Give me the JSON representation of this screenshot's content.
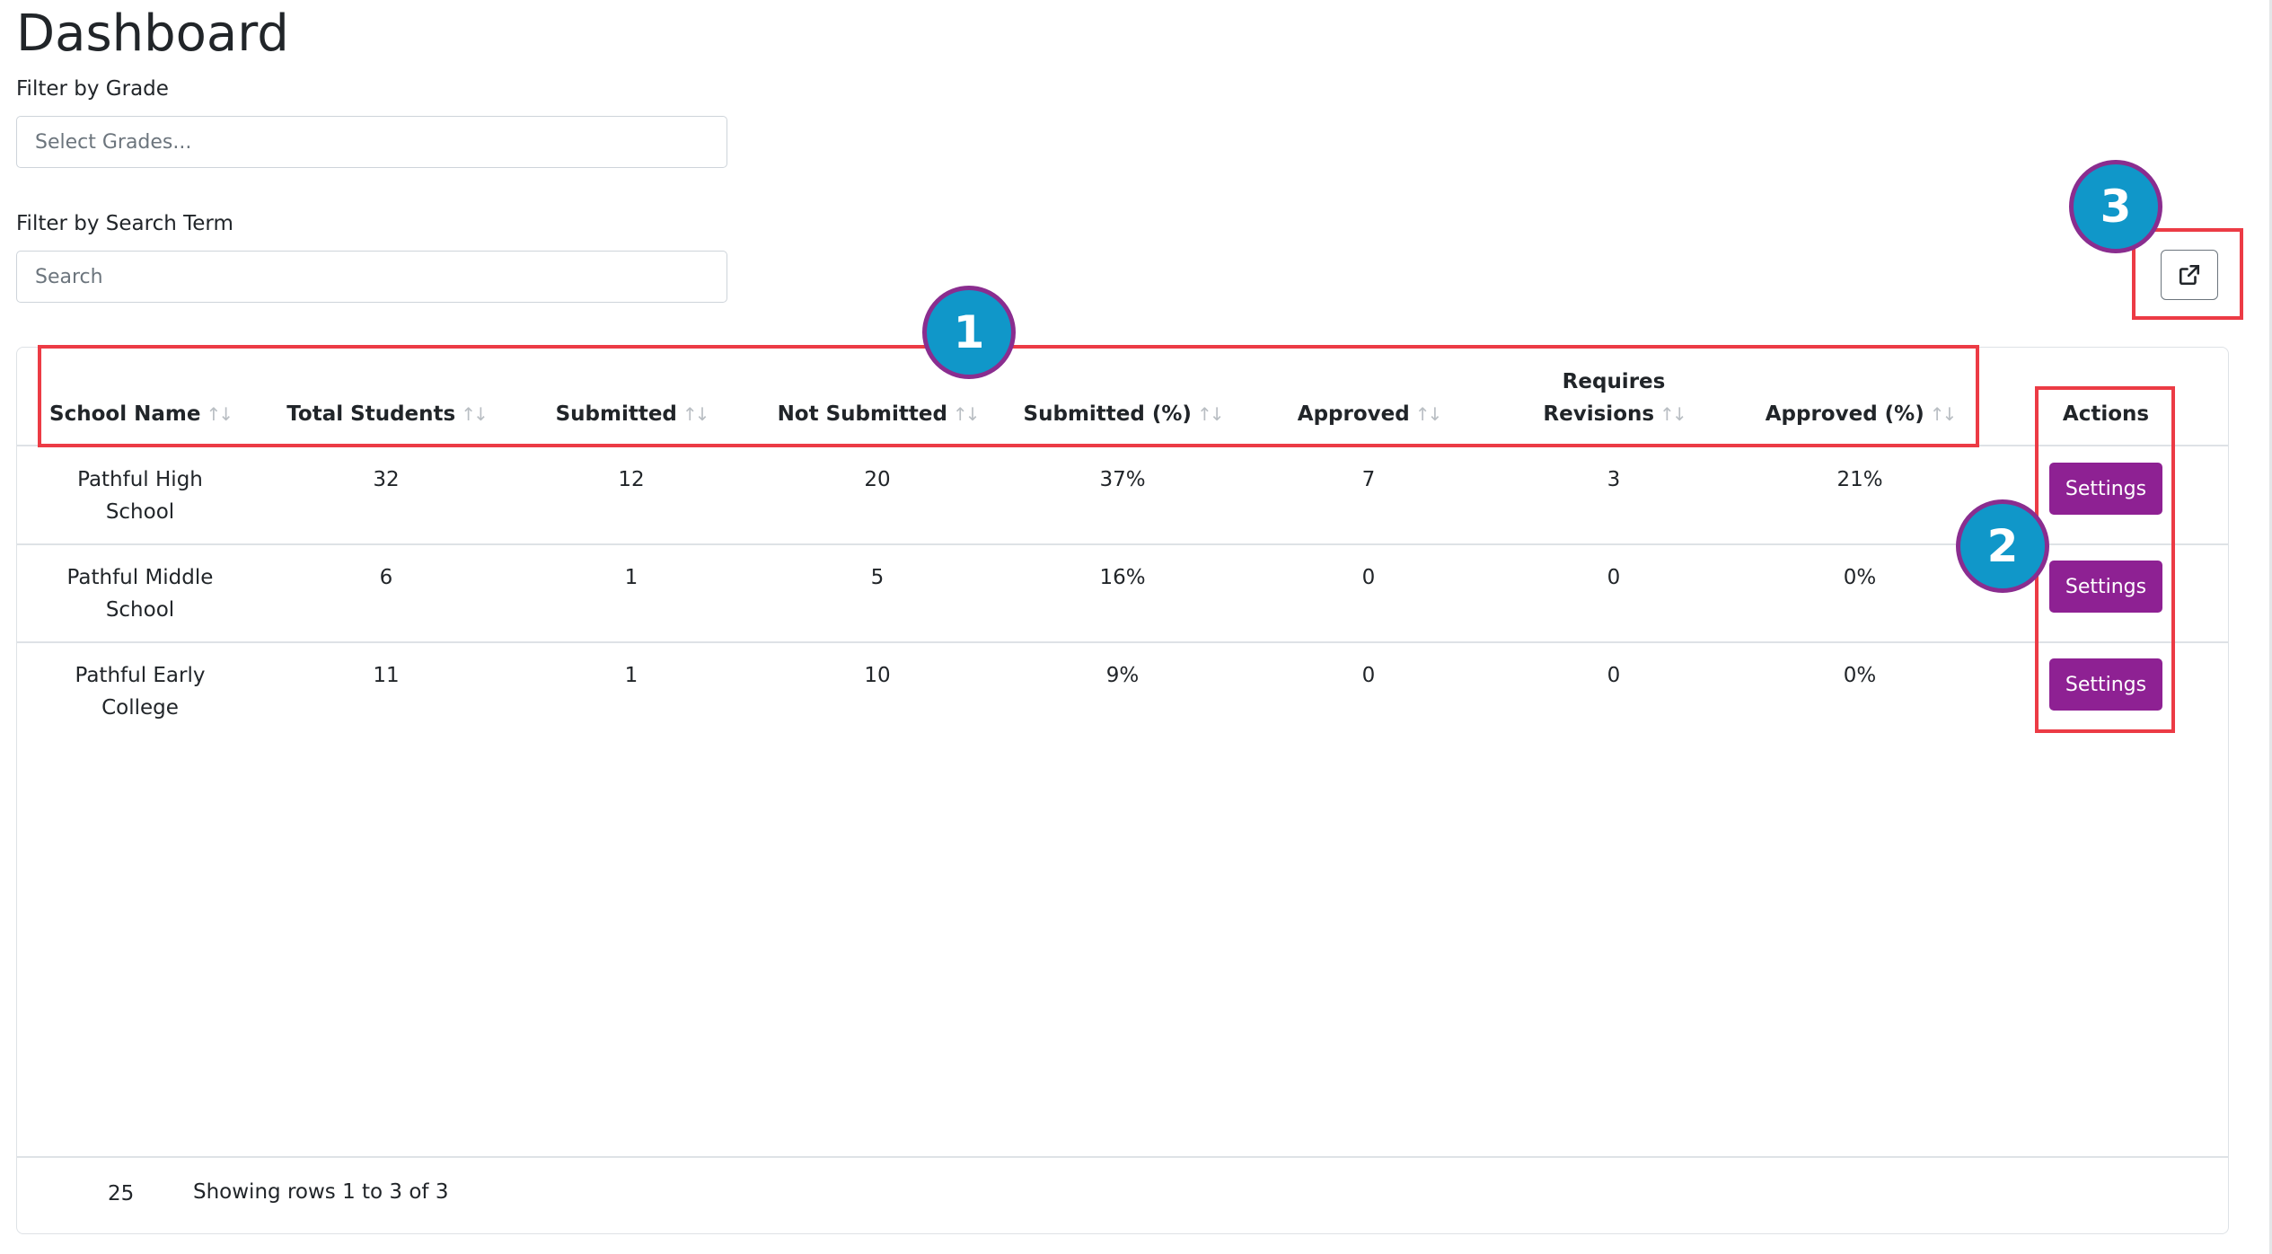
{
  "page": {
    "title": "Dashboard"
  },
  "filters": {
    "grade_label": "Filter by Grade",
    "grade_placeholder": "Select Grades...",
    "grade_value": "",
    "search_label": "Filter by Search Term",
    "search_placeholder": "Search",
    "search_value": ""
  },
  "toolbar": {
    "export_icon": "external-link-icon"
  },
  "table": {
    "columns": [
      {
        "label_lines": [
          "School Name"
        ],
        "sort_icon": "↑↓"
      },
      {
        "label_lines": [
          "Total Students"
        ],
        "sort_icon": "↑↓"
      },
      {
        "label_lines": [
          "Submitted"
        ],
        "sort_icon": "↑↓"
      },
      {
        "label_lines": [
          "Not Submitted"
        ],
        "sort_icon": "↑↓"
      },
      {
        "label_lines": [
          "Submitted (%)"
        ],
        "sort_icon": "↑↓"
      },
      {
        "label_lines": [
          "Approved"
        ],
        "sort_icon": "↑↓"
      },
      {
        "label_lines": [
          "Requires",
          "Revisions"
        ],
        "sort_icon": "↑↓"
      },
      {
        "label_lines": [
          "Approved (%)"
        ],
        "sort_icon": "↑↓"
      },
      {
        "label_lines": [
          "Actions"
        ],
        "sort_icon": ""
      }
    ],
    "rows": [
      {
        "school": "Pathful High School",
        "total": "32",
        "submitted": "12",
        "not_submitted": "20",
        "submitted_pct": "37%",
        "approved": "7",
        "revisions": "3",
        "approved_pct": "21%",
        "action": "Settings"
      },
      {
        "school": "Pathful Middle School",
        "total": "6",
        "submitted": "1",
        "not_submitted": "5",
        "submitted_pct": "16%",
        "approved": "0",
        "revisions": "0",
        "approved_pct": "0%",
        "action": "Settings"
      },
      {
        "school": "Pathful Early College",
        "total": "11",
        "submitted": "1",
        "not_submitted": "10",
        "submitted_pct": "9%",
        "approved": "0",
        "revisions": "0",
        "approved_pct": "0%",
        "action": "Settings"
      }
    ]
  },
  "footer": {
    "page_size": "25",
    "info": "Showing rows 1 to 3 of 3"
  },
  "annotations": {
    "badge_1": "1",
    "badge_2": "2",
    "badge_3": "3",
    "box_color": "#ec3b45",
    "badge_fill": "#1097c9",
    "badge_ring": "#8a2d8f"
  },
  "colors": {
    "settings_button": "#8e2193"
  }
}
